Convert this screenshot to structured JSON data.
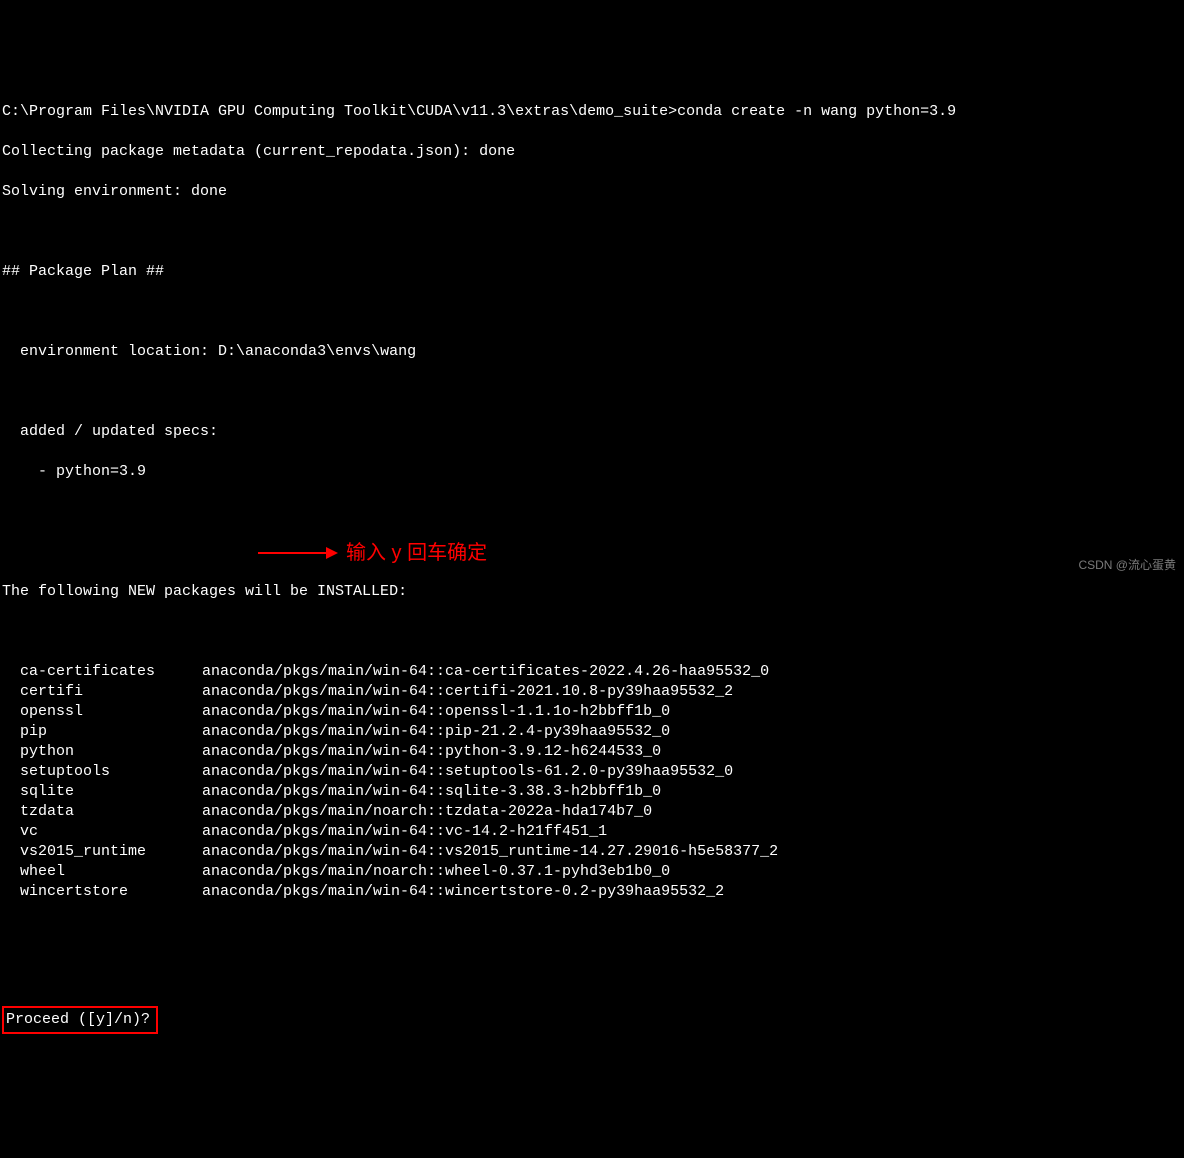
{
  "prompt": {
    "path": "C:\\Program Files\\NVIDIA GPU Computing Toolkit\\CUDA\\v11.3\\extras\\demo_suite>",
    "command": "conda create -n wang python=3.9"
  },
  "status": {
    "collecting": "Collecting package metadata (current_repodata.json): done",
    "solving": "Solving environment: done"
  },
  "plan_header": "## Package Plan ##",
  "env_location_label": "environment location: ",
  "env_location_value": "D:\\anaconda3\\envs\\wang",
  "specs_label": "added / updated specs:",
  "specs_item": "- python=3.9",
  "install_header": "The following NEW packages will be INSTALLED:",
  "packages": [
    {
      "name": "ca-certificates",
      "spec": "anaconda/pkgs/main/win-64::ca-certificates-2022.4.26-haa95532_0"
    },
    {
      "name": "certifi",
      "spec": "anaconda/pkgs/main/win-64::certifi-2021.10.8-py39haa95532_2"
    },
    {
      "name": "openssl",
      "spec": "anaconda/pkgs/main/win-64::openssl-1.1.1o-h2bbff1b_0"
    },
    {
      "name": "pip",
      "spec": "anaconda/pkgs/main/win-64::pip-21.2.4-py39haa95532_0"
    },
    {
      "name": "python",
      "spec": "anaconda/pkgs/main/win-64::python-3.9.12-h6244533_0"
    },
    {
      "name": "setuptools",
      "spec": "anaconda/pkgs/main/win-64::setuptools-61.2.0-py39haa95532_0"
    },
    {
      "name": "sqlite",
      "spec": "anaconda/pkgs/main/win-64::sqlite-3.38.3-h2bbff1b_0"
    },
    {
      "name": "tzdata",
      "spec": "anaconda/pkgs/main/noarch::tzdata-2022a-hda174b7_0"
    },
    {
      "name": "vc",
      "spec": "anaconda/pkgs/main/win-64::vc-14.2-h21ff451_1"
    },
    {
      "name": "vs2015_runtime",
      "spec": "anaconda/pkgs/main/win-64::vs2015_runtime-14.27.29016-h5e58377_2"
    },
    {
      "name": "wheel",
      "spec": "anaconda/pkgs/main/noarch::wheel-0.37.1-pyhd3eb1b0_0"
    },
    {
      "name": "wincertstore",
      "spec": "anaconda/pkgs/main/win-64::wincertstore-0.2-py39haa95532_2"
    }
  ],
  "proceed_prompt": "Proceed ([y]/n)?",
  "annotation": "输入 y 回车确定",
  "watermark": "CSDN @流心蛋黄"
}
